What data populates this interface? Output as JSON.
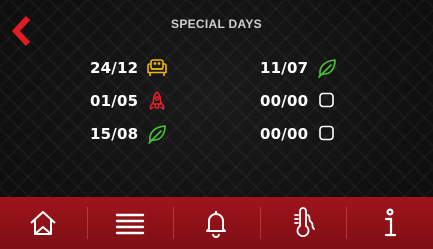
{
  "header": {
    "title": "SPECIAL DAYS",
    "back_icon": "chevron-left-icon",
    "back_color": "#e01b24"
  },
  "days": [
    {
      "date": "24/12",
      "icon": "sofa-icon",
      "color": "#f2b705"
    },
    {
      "date": "01/05",
      "icon": "rocket-icon",
      "color": "#e3202b"
    },
    {
      "date": "15/08",
      "icon": "leaf-icon",
      "color": "#4cc23a"
    },
    {
      "date": "11/07",
      "icon": "leaf-icon",
      "color": "#4cc23a"
    },
    {
      "date": "00/00",
      "icon": "empty-checkbox-icon",
      "color": "#ffffff"
    },
    {
      "date": "00/00",
      "icon": "empty-checkbox-icon",
      "color": "#ffffff"
    }
  ],
  "nav": {
    "background": "#8e1218",
    "items": [
      "home-icon",
      "menu-icon",
      "bell-icon",
      "thermometer-icon",
      "info-icon"
    ]
  }
}
